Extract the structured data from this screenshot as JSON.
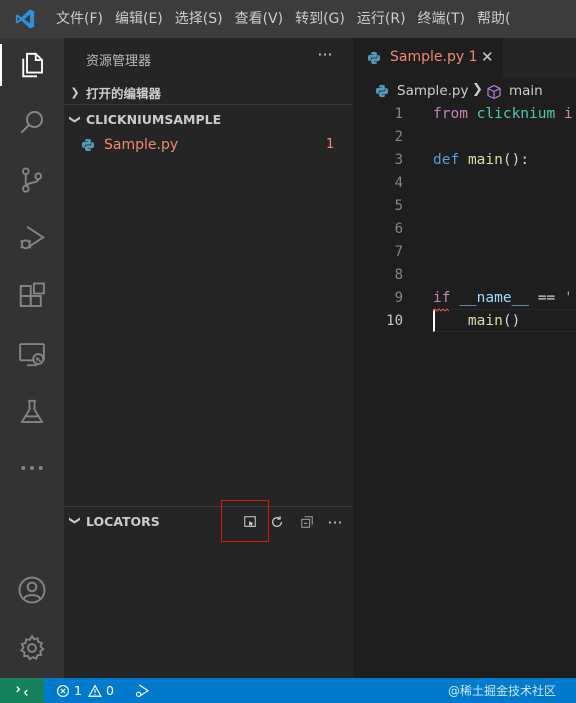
{
  "titlebar": {
    "logo_icon": "vscode-logo-icon",
    "menu": [
      "文件(F)",
      "编辑(E)",
      "选择(S)",
      "查看(V)",
      "转到(G)",
      "运行(R)",
      "终端(T)",
      "帮助("
    ]
  },
  "activitybar": {
    "items": [
      {
        "name": "explorer-icon",
        "active": true
      },
      {
        "name": "search-icon",
        "active": false
      },
      {
        "name": "source-control-icon",
        "active": false
      },
      {
        "name": "run-debug-icon",
        "active": false
      },
      {
        "name": "extensions-icon",
        "active": false
      },
      {
        "name": "remote-explorer-icon",
        "active": false
      },
      {
        "name": "testing-icon",
        "active": false
      },
      {
        "name": "more-icon",
        "active": false
      },
      {
        "name": "account-icon",
        "active": false
      },
      {
        "name": "settings-gear-icon",
        "active": false
      }
    ]
  },
  "sidebar": {
    "title": "资源管理器",
    "more": "···",
    "open_editors": "打开的编辑器",
    "folder": "CLICKNIUMSAMPLE",
    "file": {
      "name": "Sample.py",
      "problems": "1"
    },
    "locators": {
      "label": "LOCATORS",
      "more": "···",
      "toolbar_icons": [
        "capture-locator-icon",
        "refresh-icon",
        "collapse-all-icon"
      ]
    }
  },
  "editor": {
    "tab": {
      "name": "Sample.py",
      "problems": "1",
      "close": "✕"
    },
    "breadcrumb": {
      "file": "Sample.py",
      "symbol": "main"
    },
    "line_numbers": [
      "1",
      "2",
      "3",
      "4",
      "5",
      "6",
      "7",
      "8",
      "9",
      "10"
    ],
    "current_line": "10",
    "code": {
      "line1_kw": "from",
      "line1_mod": "clicknium",
      "line1_rest": "i",
      "line3_kw": "def",
      "line3_fn": "main",
      "line3_rest": "():",
      "line9_kw": "if",
      "line9_var": "__name__",
      "line9_op": "==",
      "line9_str": "'",
      "line10_fn": "main",
      "line10_rest": "()"
    }
  },
  "statusbar": {
    "remote_icon": "remote-indicator-icon",
    "errors": "1",
    "warnings": "0",
    "watermark": "@稀土掘金技术社区"
  },
  "colors": {
    "accent": "#007acc",
    "error_text": "#f48771",
    "highlight": "#e51400",
    "remote_bg": "#16825d"
  }
}
